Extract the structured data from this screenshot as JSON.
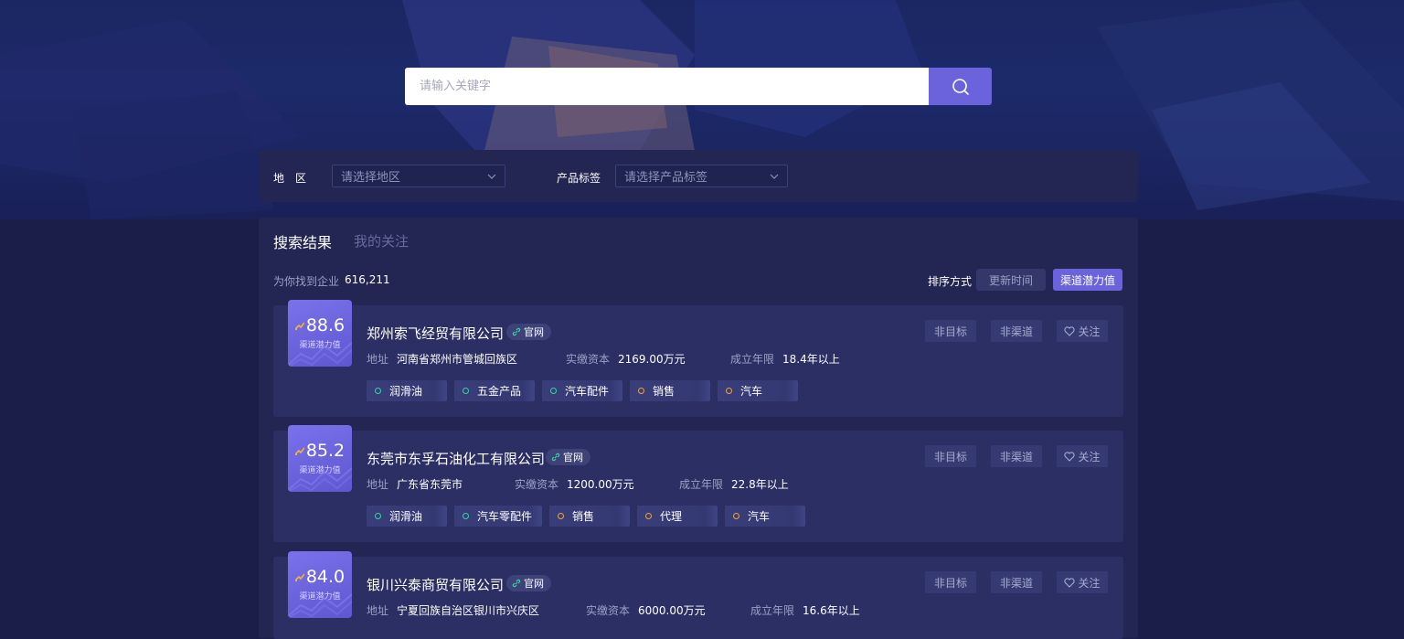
{
  "search": {
    "placeholder": "请输入关键字"
  },
  "filters": {
    "region_label": "地　区",
    "region_placeholder": "请选择地区",
    "product_label": "产品标签",
    "product_placeholder": "请选择产品标签"
  },
  "tabs": {
    "active": "搜索结果",
    "inactive": "我的关注"
  },
  "summary": {
    "count_label": "为你找到企业",
    "count_value": "616,211"
  },
  "sort": {
    "label": "排序方式",
    "options": [
      "更新时间",
      "渠道潜力值"
    ],
    "selected": "渠道潜力值"
  },
  "card_labels": {
    "score_label": "渠道潜力值",
    "official": "官网",
    "address": "地址",
    "capital": "实缴资本",
    "years": "成立年限",
    "not_target": "非目标",
    "not_channel": "非渠道",
    "follow": "关注"
  },
  "companies": [
    {
      "score": "88.6",
      "name": "郑州索飞经贸有限公司",
      "address": "河南省郑州市管城回族区",
      "capital": "2169.00万元",
      "years": "18.4年以上",
      "tags": [
        {
          "label": "润滑油",
          "color": "green"
        },
        {
          "label": "五金产品",
          "color": "green"
        },
        {
          "label": "汽车配件",
          "color": "green"
        },
        {
          "label": "销售",
          "color": "orange"
        },
        {
          "label": "汽车",
          "color": "orange"
        }
      ]
    },
    {
      "score": "85.2",
      "name": "东莞市东孚石油化工有限公司",
      "address": "广东省东莞市",
      "capital": "1200.00万元",
      "years": "22.8年以上",
      "tags": [
        {
          "label": "润滑油",
          "color": "green"
        },
        {
          "label": "汽车零配件",
          "color": "green"
        },
        {
          "label": "销售",
          "color": "orange"
        },
        {
          "label": "代理",
          "color": "orange"
        },
        {
          "label": "汽车",
          "color": "orange"
        }
      ]
    },
    {
      "score": "84.0",
      "name": "银川兴泰商贸有限公司",
      "address": "宁夏回族自治区银川市兴庆区",
      "capital": "6000.00万元",
      "years": "16.6年以上",
      "tags": []
    }
  ],
  "colors": {
    "accent": "#6b63dc",
    "background": "#1b1e48",
    "panel": "#232652",
    "card": "#2b2f64",
    "tag_green": "#3bd3a3",
    "tag_orange": "#f0a040"
  }
}
